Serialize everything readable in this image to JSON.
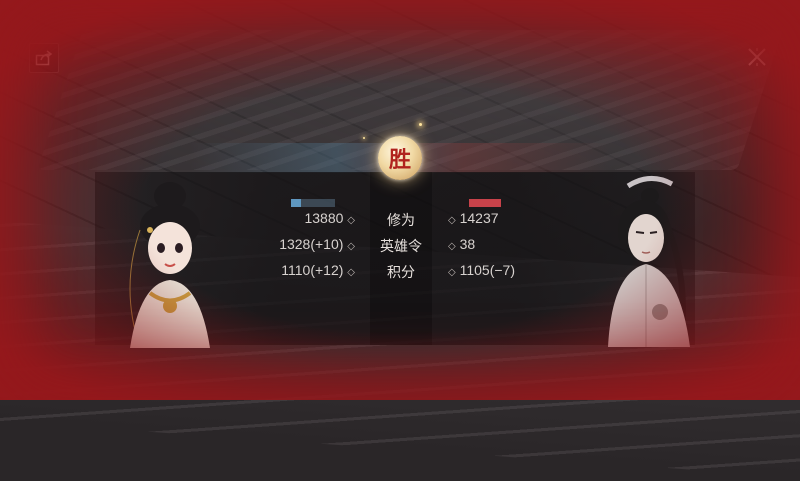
{
  "header": {
    "share_icon": "share-icon",
    "close_icon": "close-icon"
  },
  "result": {
    "badge_text": "胜"
  },
  "stats": {
    "rows": [
      {
        "label": "修为",
        "left": "13880",
        "right": "14237"
      },
      {
        "label": "英雄令",
        "left": "1328(+10)",
        "right": "38"
      },
      {
        "label": "积分",
        "left": "1110(+12)",
        "right": "1105(−7)"
      }
    ],
    "separator": "◇"
  },
  "colors": {
    "win_red": "#b0221d",
    "left_bar": "#5f97c0",
    "right_bar": "#c8424a",
    "vignette": "#961a1e"
  }
}
